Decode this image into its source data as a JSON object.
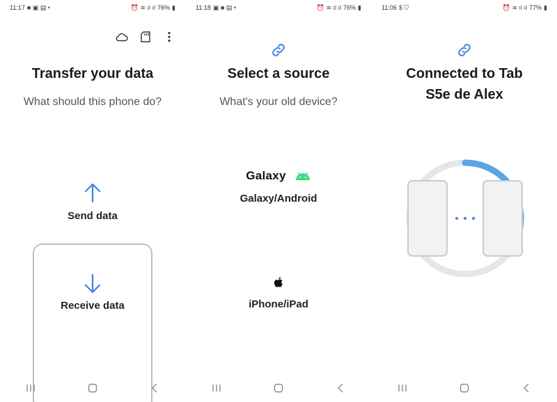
{
  "panel1": {
    "status": {
      "time": "11:17",
      "battery": "76%"
    },
    "title": "Transfer your data",
    "subtitle": "What should this phone do?",
    "send_label": "Send data",
    "receive_label": "Receive data"
  },
  "panel2": {
    "status": {
      "time": "11:18",
      "battery": "76%"
    },
    "title": "Select a source",
    "subtitle": "What's your old device?",
    "galaxy_logo": "Galaxy",
    "galaxy_label": "Galaxy/Android",
    "iphone_label": "iPhone/iPad"
  },
  "panel3": {
    "status": {
      "time": "11:06",
      "battery": "77%"
    },
    "title_line1": "Connected to Tab",
    "title_line2": "S5e de Alex",
    "progress_fraction": 0.28
  },
  "colors": {
    "accent": "#3d7fe0",
    "link_blue": "#4a8ee6",
    "android_green": "#3ddc84",
    "progress_blue": "#5aa5e3",
    "ring_gray": "#e4e6e8"
  },
  "icons": {
    "cloud": "cloud-icon",
    "sdcard": "sd-card-icon",
    "more": "more-options-icon",
    "link": "link-icon",
    "android": "android-icon",
    "apple": "apple-icon"
  }
}
